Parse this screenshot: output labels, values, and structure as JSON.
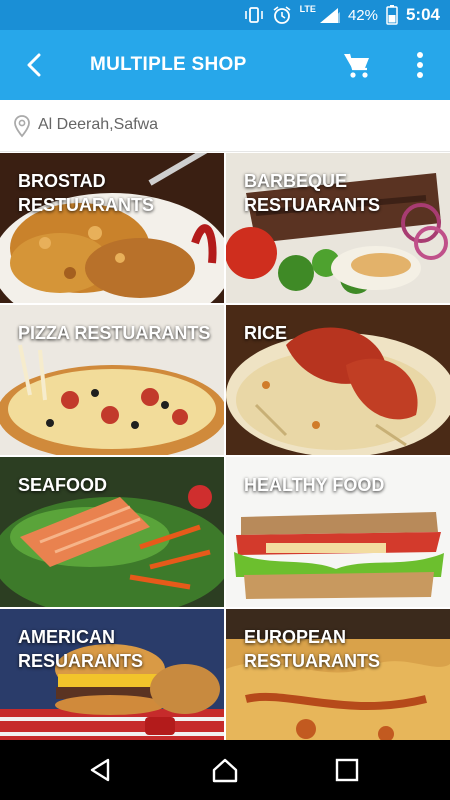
{
  "status_bar": {
    "battery": "42%",
    "time": "5:04",
    "network": "LTE",
    "icons": [
      "vibrate-icon",
      "alarm-icon",
      "signal-icon",
      "battery-icon"
    ]
  },
  "app_bar": {
    "title": "MULTIPLE SHOP",
    "back_icon": "back-arrow-icon",
    "cart_icon": "cart-icon",
    "more_icon": "more-vert-icon"
  },
  "location": {
    "icon": "location-pin-icon",
    "text": "Al Deerah,Safwa"
  },
  "categories": [
    {
      "label": "BROSTAD RESTUARANTS"
    },
    {
      "label": "BARBEQUE RESTUARANTS"
    },
    {
      "label": "PIZZA RESTUARANTS"
    },
    {
      "label": "RICE"
    },
    {
      "label": "SEAFOOD"
    },
    {
      "label": "HEALTHY FOOD"
    },
    {
      "label": "AMERICAN RESUARANTS"
    },
    {
      "label": "EUROPEAN RESTUARANTS"
    }
  ],
  "nav_bar": {
    "back_icon": "nav-back-icon",
    "home_icon": "nav-home-icon",
    "recents_icon": "nav-recents-icon"
  },
  "colors": {
    "status_bar": "#1a8fd6",
    "app_bar": "#27a7ea"
  }
}
